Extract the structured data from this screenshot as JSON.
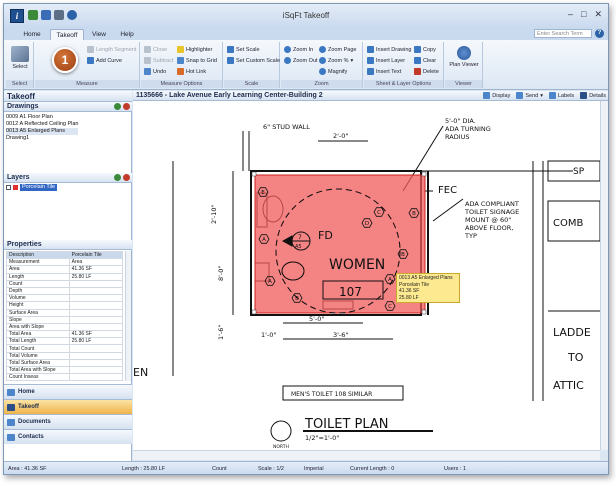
{
  "app": {
    "title": "iSqFt Takeoff"
  },
  "tabs": [
    "Home",
    "Takeoff",
    "View",
    "Help"
  ],
  "search": {
    "placeholder": "Enter Search Term"
  },
  "ribbon": {
    "select": {
      "label": "Select",
      "group": "Select"
    },
    "measure": {
      "items": [
        "Length Segment",
        "Add Curve"
      ],
      "group": "Measure"
    },
    "measure_options": {
      "items": [
        "Close",
        "Subtract",
        "Undo",
        "Highlighter",
        "Snap to Grid",
        "Hot Link"
      ],
      "group": "Measure Options"
    },
    "scale": {
      "items": [
        "Set Scale",
        "Set Custom Scale"
      ],
      "group": "Scale"
    },
    "zoom": {
      "items": [
        "Zoom In",
        "Zoom Out",
        "Zoom Page",
        "Zoom %",
        "Magnify"
      ],
      "group": "Zoom"
    },
    "sheet": {
      "items": [
        "Insert Drawing",
        "Insert Layer",
        "Insert Text",
        "Copy",
        "Clear",
        "Delete"
      ],
      "group": "Sheet & Layer Options"
    },
    "viewer": {
      "label": "Plan Viewer",
      "group": "Viewer"
    }
  },
  "step_badge": "1",
  "pane": {
    "title": "Takeoff"
  },
  "drawings": {
    "title": "Drawings",
    "items": [
      "0009 A1 Floor Plan",
      "0012 A Reflected Ceiling Plan",
      "0013 A5 Enlarged Plans",
      "Drawing1"
    ]
  },
  "layers": {
    "title": "Layers",
    "items": [
      "Porcelain Tile"
    ]
  },
  "properties": {
    "title": "Properties",
    "rows": [
      [
        "Description",
        "Porcelain Tile"
      ],
      [
        "Measurement",
        "Area"
      ],
      [
        "Area",
        "41.36 SF"
      ],
      [
        "Length",
        "25.80 LF"
      ],
      [
        "Count",
        ""
      ],
      [
        "Depth",
        ""
      ],
      [
        "Volume",
        ""
      ],
      [
        "Height",
        ""
      ],
      [
        "Surface Area",
        ""
      ],
      [
        "Slope",
        ""
      ],
      [
        "Area with Slope",
        ""
      ],
      [
        "Total Area",
        "41.36 SF"
      ],
      [
        "Total Length",
        "25.80 LF"
      ],
      [
        "Total Count",
        ""
      ],
      [
        "Total Volume",
        ""
      ],
      [
        "Total Surface Area",
        ""
      ],
      [
        "Total Area with Slope",
        ""
      ],
      [
        "Count Inseas",
        ""
      ]
    ]
  },
  "nav": [
    "Home",
    "Takeoff",
    "Documents",
    "Contacts"
  ],
  "canvas": {
    "title": "1135666 - Lake Avenue Early Learning Center-Building 2",
    "tools": [
      "Display",
      "Send",
      "Labels",
      "Details"
    ]
  },
  "plan": {
    "stud_wall": "6\" STUD WALL",
    "dim_top": "2'-0\"",
    "dim_left": "2'-10\"",
    "dim_left2": "8'-0\"",
    "dim_left3": "1'-6\"",
    "dim_bottom1": "5'-0\"",
    "dim_bottom2": "1'-0\"",
    "dim_bottom3": "3'-6\"",
    "room_name": "WOMEN",
    "room_number": "107",
    "fd": "FD",
    "tag_top": "7",
    "tag_bottom": "A5",
    "note1": [
      "5'-0\" DIA.",
      "ADA TURNING",
      "RADIUS"
    ],
    "fec": "FEC",
    "note2": [
      "ADA COMPLIANT",
      "TOILET SIGNAGE",
      "MOUNT @ 60\"",
      "ABOVE FLOOR,",
      "TYP"
    ],
    "right_text": [
      "LADDE",
      "TO",
      "ATTIC"
    ],
    "combo": "COMB",
    "sp": "SP",
    "en": "EN",
    "mens_note": "MEN'S TOILET 108 SIMILAR",
    "plan_title": "TOILET PLAN",
    "plan_scale": "1/2\"=1'-0\"",
    "north": "NORTH",
    "tags": [
      "E",
      "A",
      "A",
      "C",
      "B",
      "A",
      "C",
      "D",
      "B",
      "B"
    ]
  },
  "tooltip": [
    "0013 A5 Enlarged Plans",
    "Porcelain Tile",
    "41.36 SF",
    "25.80 LF"
  ],
  "status": {
    "area": "Area : 41.36 SF",
    "length": "Length : 25.80 LF",
    "count": "Count",
    "scale": "Scale : 1/2",
    "units": "Imperial",
    "layer": "Current Length : 0",
    "users": "Users : 1"
  },
  "colors": {
    "fill": "#f05a5a",
    "fill_alpha": 0.75,
    "accent": "#1f4f8f"
  }
}
